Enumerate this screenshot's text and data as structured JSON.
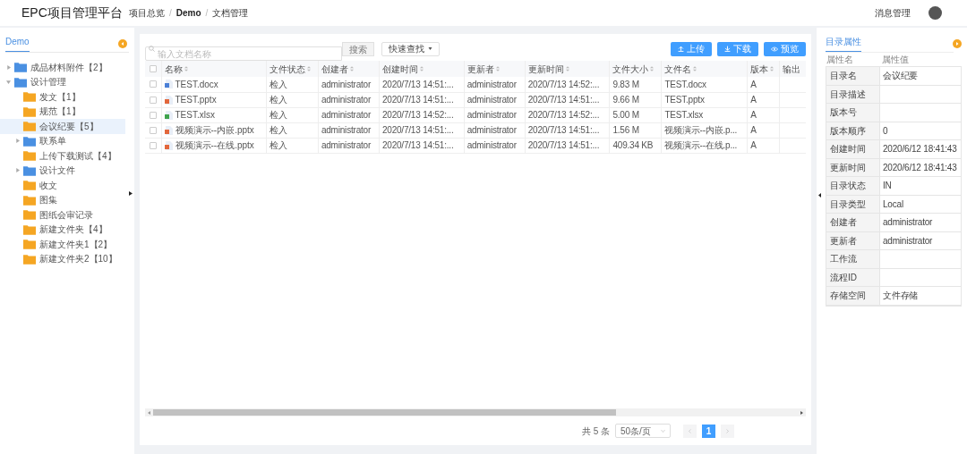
{
  "header": {
    "title": "EPC项目管理平台",
    "breadcrumb": [
      {
        "label": "项目总览",
        "current": false
      },
      {
        "label": "Demo",
        "current": true
      },
      {
        "label": "文档管理",
        "current": false
      }
    ],
    "separator": "/",
    "message_link": "消息管理"
  },
  "sidebar": {
    "tab": "Demo",
    "tree": [
      {
        "label": "成品材料附件【2】",
        "kind": "group",
        "expanded": false,
        "selected": false
      },
      {
        "label": "设计管理",
        "kind": "group",
        "expanded": true,
        "selected": false,
        "children": [
          {
            "label": "发文【1】",
            "kind": "leaf",
            "selected": false
          },
          {
            "label": "规范【1】",
            "kind": "leaf",
            "selected": false
          },
          {
            "label": "会议纪要【5】",
            "kind": "leaf",
            "selected": true
          },
          {
            "label": "联系单",
            "kind": "group",
            "expanded": false,
            "selected": false
          },
          {
            "label": "上传下载测试【4】",
            "kind": "leaf",
            "selected": false
          },
          {
            "label": "设计文件",
            "kind": "group",
            "expanded": false,
            "selected": false
          },
          {
            "label": "收文",
            "kind": "leaf",
            "selected": false
          },
          {
            "label": "图集",
            "kind": "leaf",
            "selected": false
          },
          {
            "label": "图纸会审记录",
            "kind": "leaf",
            "selected": false
          },
          {
            "label": "新建文件夹【4】",
            "kind": "leaf",
            "selected": false
          },
          {
            "label": "新建文件夹1【2】",
            "kind": "leaf",
            "selected": false
          },
          {
            "label": "新建文件夹2【10】",
            "kind": "leaf",
            "selected": false
          }
        ]
      }
    ]
  },
  "toolbar": {
    "search_placeholder": "输入文档名称",
    "search_button": "搜索",
    "quick_find": "快速查找",
    "actions": [
      {
        "label": "上传",
        "kind": "upload"
      },
      {
        "label": "下载",
        "kind": "download"
      },
      {
        "label": "预览",
        "kind": "preview"
      }
    ]
  },
  "table": {
    "all_checked": false,
    "columns": [
      "名称",
      "文件状态",
      "创建者",
      "创建时间",
      "更新者",
      "更新时间",
      "文件大小",
      "文件名",
      "版本",
      "输出"
    ],
    "rows": [
      {
        "kind": "word",
        "checked": false,
        "cells": [
          "TEST.docx",
          "检入",
          "administrator",
          "2020/7/13 14:51:...",
          "administrator",
          "2020/7/13 14:52:...",
          "9.83 M",
          "TEST.docx",
          "A"
        ]
      },
      {
        "kind": "ppt",
        "checked": false,
        "cells": [
          "TEST.pptx",
          "检入",
          "administrator",
          "2020/7/13 14:51:...",
          "administrator",
          "2020/7/13 14:51:...",
          "9.66 M",
          "TEST.pptx",
          "A"
        ]
      },
      {
        "kind": "excel",
        "checked": false,
        "cells": [
          "TEST.xlsx",
          "检入",
          "administrator",
          "2020/7/13 14:52:...",
          "administrator",
          "2020/7/13 14:52:...",
          "5.00 M",
          "TEST.xlsx",
          "A"
        ]
      },
      {
        "kind": "ppt",
        "checked": false,
        "cells": [
          "视频演示--内嵌.pptx",
          "检入",
          "administrator",
          "2020/7/13 14:51:...",
          "administrator",
          "2020/7/13 14:51:...",
          "1.56 M",
          "视频演示--内嵌.p...",
          "A"
        ]
      },
      {
        "kind": "ppt",
        "checked": false,
        "cells": [
          "视频演示--在线.pptx",
          "检入",
          "administrator",
          "2020/7/13 14:51:...",
          "administrator",
          "2020/7/13 14:51:...",
          "409.34 KB",
          "视频演示--在线.p...",
          "A"
        ]
      }
    ]
  },
  "pagination": {
    "total": "共 5 条",
    "page_size": "50条/页",
    "pages": [
      {
        "label": "1",
        "selected": true
      }
    ]
  },
  "properties": {
    "tab": "目录属性",
    "name_header": "属性名",
    "value_header": "属性值",
    "rows": [
      {
        "name": "目录名",
        "value": "会议纪要"
      },
      {
        "name": "目录描述"
      },
      {
        "name": "版本号"
      },
      {
        "name": "版本顺序",
        "value": "0"
      },
      {
        "name": "创建时间",
        "value": "2020/6/12 18:41:43"
      },
      {
        "name": "更新时间",
        "value": "2020/6/12 18:41:43"
      },
      {
        "name": "目录状态",
        "value": "IN"
      },
      {
        "name": "目录类型",
        "value": "Local"
      },
      {
        "name": "创建者",
        "value": "administrator"
      },
      {
        "name": "更新者",
        "value": "administrator"
      },
      {
        "name": "工作流"
      },
      {
        "name": "流程ID"
      },
      {
        "name": "存储空间",
        "value": "文件存储"
      }
    ]
  }
}
